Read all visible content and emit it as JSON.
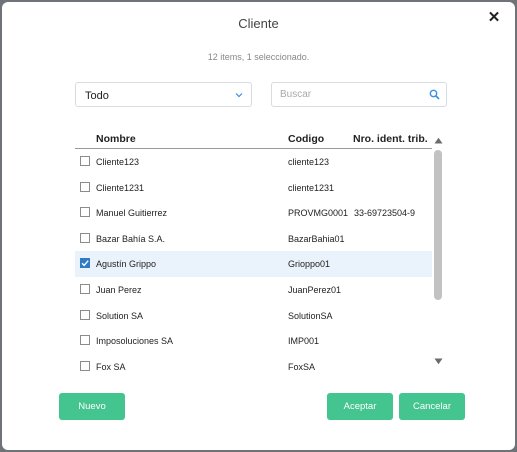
{
  "dialog": {
    "title": "Cliente",
    "summary": "12 items, 1 seleccionado.",
    "filter": {
      "selected": "Todo"
    },
    "search": {
      "placeholder": "Buscar",
      "value": ""
    },
    "columns": {
      "name": "Nombre",
      "code": "Codigo",
      "nro": "Nro. ident. trib."
    },
    "rows": [
      {
        "name": "Cliente123",
        "code": "cliente123",
        "nro": "",
        "checked": false
      },
      {
        "name": "Cliente1231",
        "code": "cliente1231",
        "nro": "",
        "checked": false
      },
      {
        "name": "Manuel Guitierrez",
        "code": "PROVMG0001",
        "nro": "33-69723504-9",
        "checked": false
      },
      {
        "name": "Bazar Bahía S.A.",
        "code": "BazarBahia01",
        "nro": "",
        "checked": false
      },
      {
        "name": "Agustín Grippo",
        "code": "Grioppo01",
        "nro": "",
        "checked": true
      },
      {
        "name": "Juan Perez",
        "code": "JuanPerez01",
        "nro": "",
        "checked": false
      },
      {
        "name": "Solution SA",
        "code": "SolutionSA",
        "nro": "",
        "checked": false
      },
      {
        "name": "Imposoluciones SA",
        "code": "IMP001",
        "nro": "",
        "checked": false
      },
      {
        "name": "Fox SA",
        "code": "FoxSA",
        "nro": "",
        "checked": false
      }
    ],
    "buttons": {
      "new": "Nuevo",
      "accept": "Aceptar",
      "cancel": "Cancelar"
    }
  },
  "icons": {
    "close": "close-icon",
    "dropdown": "chevron-down-icon",
    "search": "search-icon"
  },
  "colors": {
    "accent": "#44c48f",
    "selected_row": "#eaf2fb",
    "link": "#3a8ee6"
  }
}
